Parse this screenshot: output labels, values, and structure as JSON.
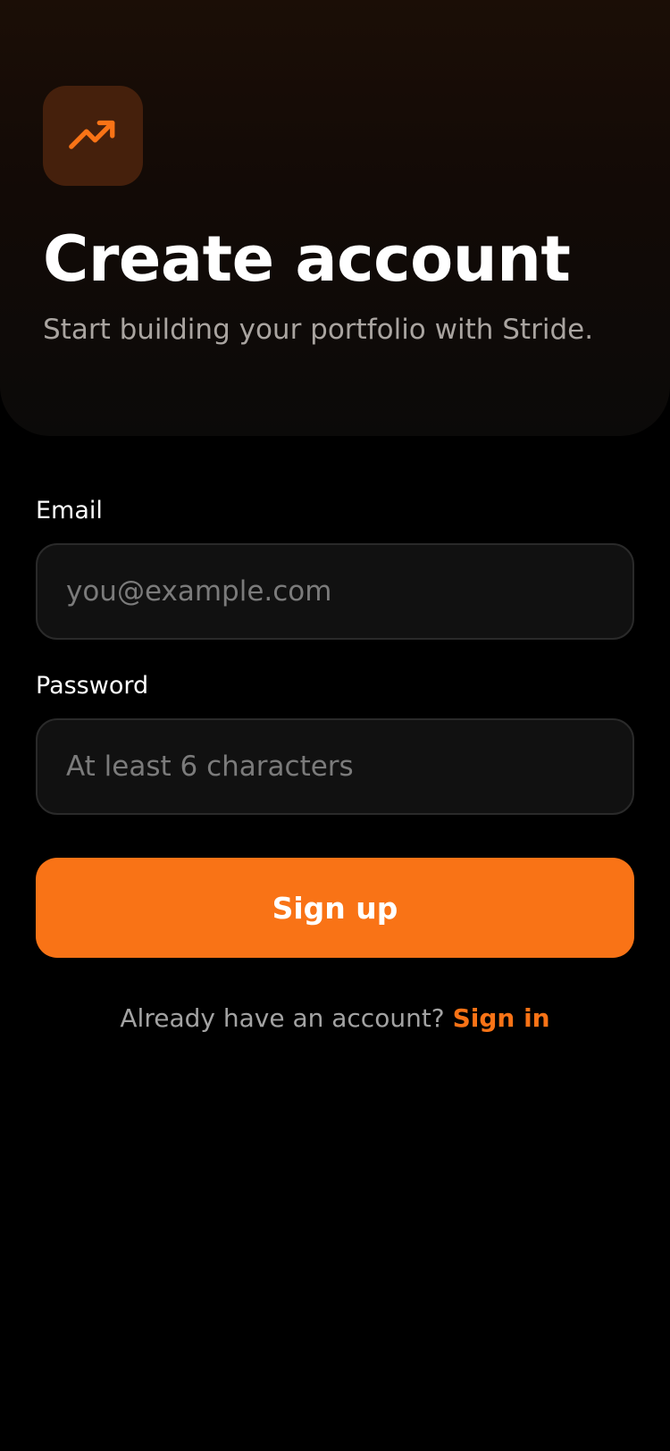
{
  "brand": {
    "icon": "trending-up-icon",
    "accent_color": "#f97316",
    "tile_color": "#45200c"
  },
  "header": {
    "title": "Create account",
    "subtitle": "Start building your portfolio with Stride."
  },
  "form": {
    "email": {
      "label": "Email",
      "value": "",
      "placeholder": "you@example.com"
    },
    "password": {
      "label": "Password",
      "value": "",
      "placeholder": "At least 6 characters"
    },
    "submit_label": "Sign up"
  },
  "footer": {
    "prompt": "Already have an account? ",
    "link_label": "Sign in"
  }
}
